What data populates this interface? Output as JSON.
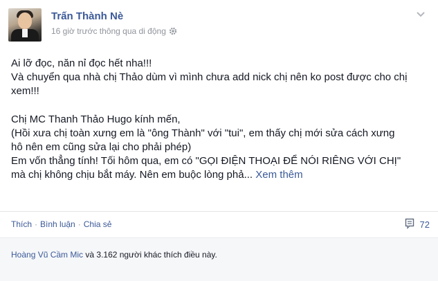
{
  "post": {
    "author": "Trấn Thành Nè",
    "meta": "16 giờ trước thông qua di động",
    "lines": [
      "Ai lỡ đọc, năn nỉ đọc hết nha!!!",
      "Và chuyển qua nhà chị Thảo dùm vì mình chưa add nick chị nên ko post được cho chị",
      "xem!!!",
      "",
      "Chị MC Thanh Thảo Hugo kính mến,",
      "(Hồi xưa chị toàn xưng em là \"ông Thành\" với \"tui\", em thấy chị mới sửa cách xưng",
      "hô nên em cũng sửa lại cho phải phép)",
      "Em vốn thẳng tính! Tối hôm qua, em có \"GỌI ĐIỆN THOẠI ĐỂ NÓI RIÊNG VỚI CHỊ\"",
      "mà chị không chịu bắt máy. Nên em buộc lòng phả..."
    ],
    "see_more": "Xem thêm"
  },
  "actions": {
    "like": "Thích",
    "comment": "Bình luận",
    "share": "Chia sẻ",
    "separator": "·",
    "comment_count": "72"
  },
  "likes": {
    "names": "Hoàng Vũ Cầm Mic",
    "rest": " và 3.162 người khác thích điều này."
  },
  "icons": {
    "privacy": "gear-icon",
    "menu": "chevron-down-icon",
    "comments": "comment-bubble-icon"
  }
}
